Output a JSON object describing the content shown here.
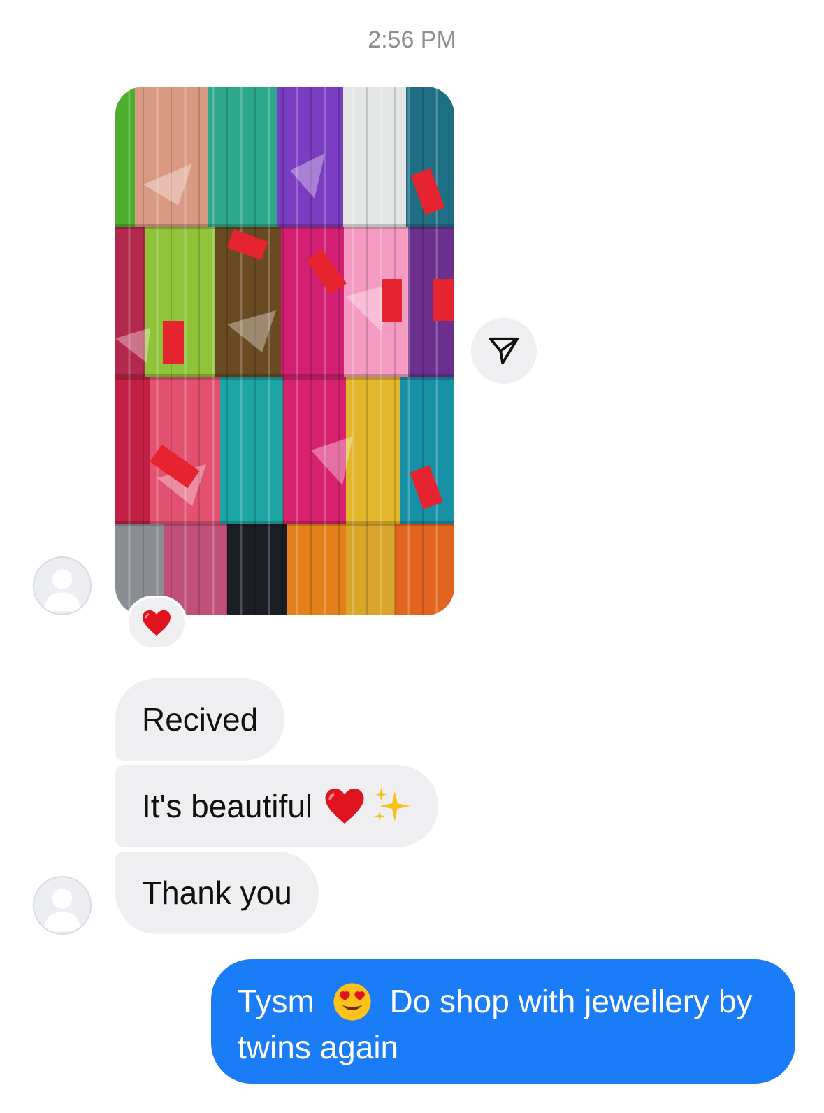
{
  "thread": {
    "timestamp": "2:56 PM"
  },
  "incoming": {
    "photo": {
      "description_icon": "bangle-photo",
      "reaction_icon": "heart-emoji-icon"
    },
    "messages": [
      {
        "text": "Recived"
      },
      {
        "text": "It's beautiful",
        "emojis": [
          "heart-emoji-icon",
          "sparkles-emoji-icon"
        ]
      },
      {
        "text": "Thank you"
      }
    ]
  },
  "outgoing": {
    "text_before_emoji": "Tysm",
    "emoji": "heart-eyes-emoji-icon",
    "text_after_emoji": "Do shop with jewellery by",
    "text_line2": "twins again"
  },
  "colors": {
    "outgoing_bubble": "#1b7cf7",
    "incoming_bubble": "#efeff1",
    "timestamp": "#8e8e8e"
  }
}
